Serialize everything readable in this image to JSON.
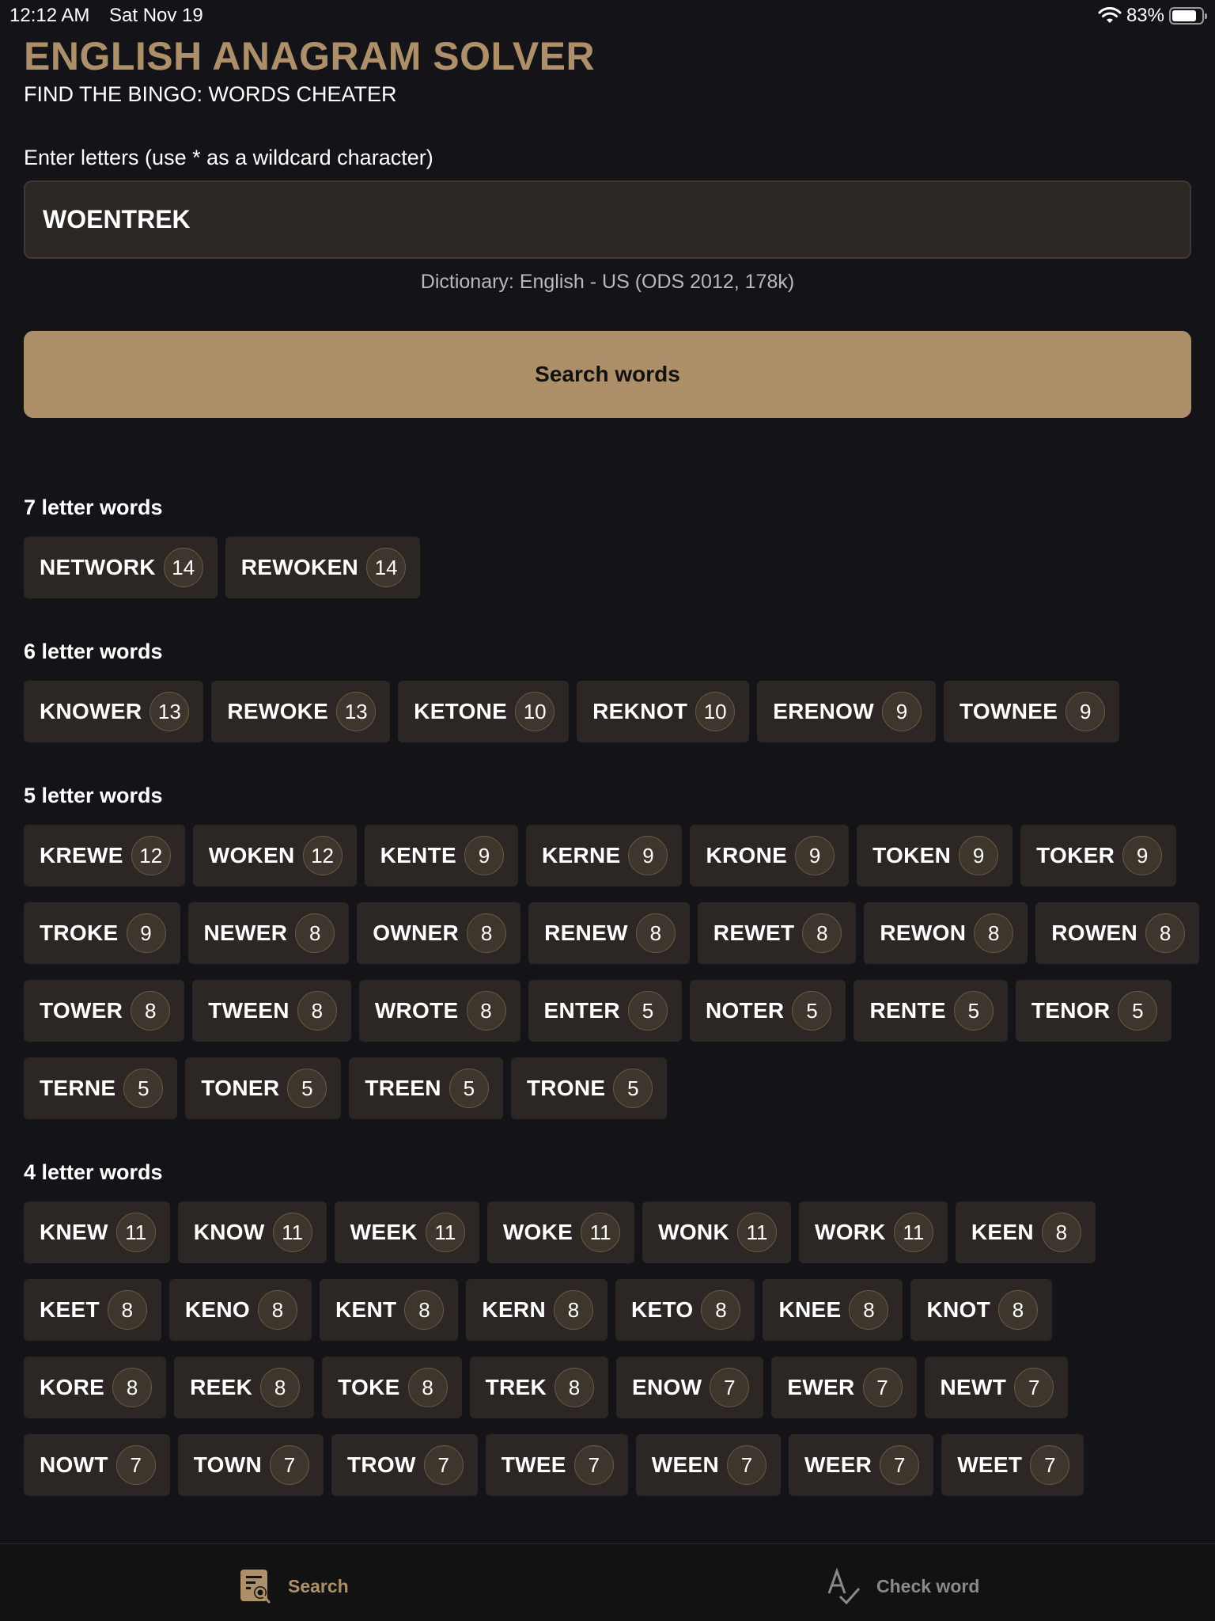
{
  "status_bar": {
    "time": "12:12 AM",
    "date": "Sat Nov 19",
    "battery_percent_label": "83%",
    "battery_level": 0.83,
    "icons": [
      "wifi-icon",
      "battery-icon"
    ]
  },
  "header": {
    "title": "ENGLISH ANAGRAM SOLVER",
    "subtitle": "FIND THE BINGO: WORDS CHEATER"
  },
  "colors": {
    "accent": "#ad9069",
    "background": "#141318",
    "chip_background": "#2c2725",
    "score_badge": "#3e352c"
  },
  "search": {
    "label": "Enter letters (use * as a wildcard character)",
    "value": "WOENTREK",
    "dictionary_note": "Dictionary: English - US (ODS 2012, 178k)",
    "button_label": "Search words"
  },
  "results": [
    {
      "title": "7 letter words",
      "words": [
        {
          "word": "NETWORK",
          "score": "14"
        },
        {
          "word": "REWOKEN",
          "score": "14"
        }
      ]
    },
    {
      "title": "6 letter words",
      "words": [
        {
          "word": "KNOWER",
          "score": "13"
        },
        {
          "word": "REWOKE",
          "score": "13"
        },
        {
          "word": "KETONE",
          "score": "10"
        },
        {
          "word": "REKNOT",
          "score": "10"
        },
        {
          "word": "ERENOW",
          "score": "9"
        },
        {
          "word": "TOWNEE",
          "score": "9"
        }
      ]
    },
    {
      "title": "5 letter words",
      "words": [
        {
          "word": "KREWE",
          "score": "12"
        },
        {
          "word": "WOKEN",
          "score": "12"
        },
        {
          "word": "KENTE",
          "score": "9"
        },
        {
          "word": "KERNE",
          "score": "9"
        },
        {
          "word": "KRONE",
          "score": "9"
        },
        {
          "word": "TOKEN",
          "score": "9"
        },
        {
          "word": "TOKER",
          "score": "9"
        },
        {
          "word": "TROKE",
          "score": "9"
        },
        {
          "word": "NEWER",
          "score": "8"
        },
        {
          "word": "OWNER",
          "score": "8"
        },
        {
          "word": "RENEW",
          "score": "8"
        },
        {
          "word": "REWET",
          "score": "8"
        },
        {
          "word": "REWON",
          "score": "8"
        },
        {
          "word": "ROWEN",
          "score": "8"
        },
        {
          "word": "TOWER",
          "score": "8"
        },
        {
          "word": "TWEEN",
          "score": "8"
        },
        {
          "word": "WROTE",
          "score": "8"
        },
        {
          "word": "ENTER",
          "score": "5"
        },
        {
          "word": "NOTER",
          "score": "5"
        },
        {
          "word": "RENTE",
          "score": "5"
        },
        {
          "word": "TENOR",
          "score": "5"
        },
        {
          "word": "TERNE",
          "score": "5"
        },
        {
          "word": "TONER",
          "score": "5"
        },
        {
          "word": "TREEN",
          "score": "5"
        },
        {
          "word": "TRONE",
          "score": "5"
        }
      ]
    },
    {
      "title": "4 letter words",
      "words": [
        {
          "word": "KNEW",
          "score": "11"
        },
        {
          "word": "KNOW",
          "score": "11"
        },
        {
          "word": "WEEK",
          "score": "11"
        },
        {
          "word": "WOKE",
          "score": "11"
        },
        {
          "word": "WONK",
          "score": "11"
        },
        {
          "word": "WORK",
          "score": "11"
        },
        {
          "word": "KEEN",
          "score": "8"
        },
        {
          "word": "KEET",
          "score": "8"
        },
        {
          "word": "KENO",
          "score": "8"
        },
        {
          "word": "KENT",
          "score": "8"
        },
        {
          "word": "KERN",
          "score": "8"
        },
        {
          "word": "KETO",
          "score": "8"
        },
        {
          "word": "KNEE",
          "score": "8"
        },
        {
          "word": "KNOT",
          "score": "8"
        },
        {
          "word": "KORE",
          "score": "8"
        },
        {
          "word": "REEK",
          "score": "8"
        },
        {
          "word": "TOKE",
          "score": "8"
        },
        {
          "word": "TREK",
          "score": "8"
        },
        {
          "word": "ENOW",
          "score": "7"
        },
        {
          "word": "EWER",
          "score": "7"
        },
        {
          "word": "NEWT",
          "score": "7"
        },
        {
          "word": "NOWT",
          "score": "7"
        },
        {
          "word": "TOWN",
          "score": "7"
        },
        {
          "word": "TROW",
          "score": "7"
        },
        {
          "word": "TWEE",
          "score": "7"
        },
        {
          "word": "WEEN",
          "score": "7"
        },
        {
          "word": "WEER",
          "score": "7"
        },
        {
          "word": "WEET",
          "score": "7"
        }
      ]
    }
  ],
  "tab_bar": {
    "tabs": [
      {
        "label": "Search",
        "icon": "search-document-icon",
        "active": true
      },
      {
        "label": "Check word",
        "icon": "spell-check-icon",
        "active": false
      }
    ]
  }
}
